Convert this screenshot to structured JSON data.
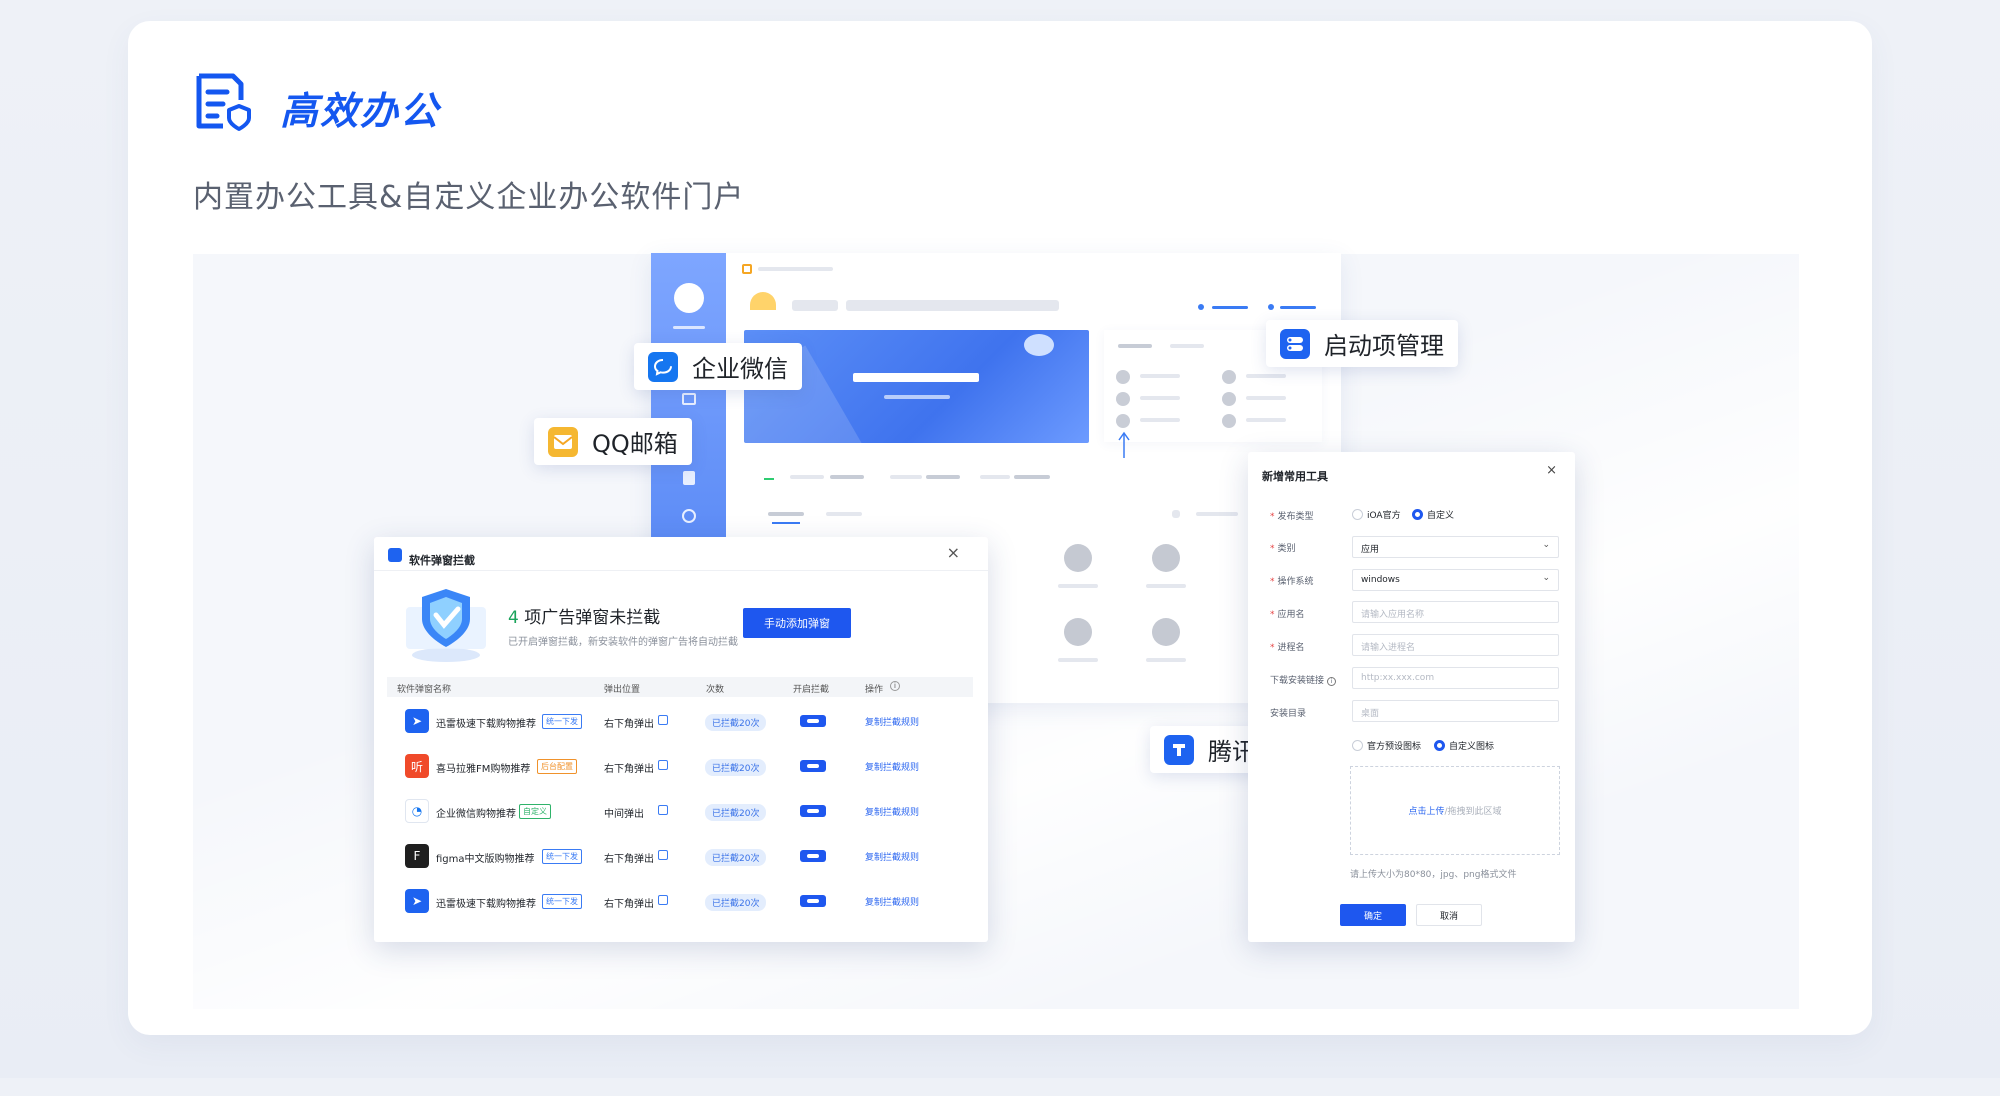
{
  "header": {
    "title": "高效办公",
    "subtitle": "内置办公工具&自定义企业办公软件门户"
  },
  "tags": {
    "wecom": "企业微信",
    "qqmail": "QQ邮箱",
    "startup": "启动项管理",
    "tdocs": "腾讯文档"
  },
  "popup": {
    "title": "软件弹窗拦截",
    "count_num": "4",
    "count_text": " 项广告弹窗未拦截",
    "desc": "已开启弹窗拦截，新安装软件的弹窗广告将自动拦截",
    "add_button": "手动添加弹窗",
    "close": "×",
    "columns": [
      "软件弹窗名称",
      "弹出位置",
      "次数",
      "开启拦截",
      "操作"
    ],
    "rows": [
      {
        "name": "迅雷极速下载购物推荐",
        "badge": "统一下发",
        "position": "右下角弹出",
        "count": "已拦截20次",
        "action": "复制拦截规则",
        "color": "#1e63f0",
        "glyph": "➤"
      },
      {
        "name": "喜马拉雅FM购物推荐",
        "badge": "后台配置",
        "position": "右下角弹出",
        "count": "已拦截20次",
        "action": "复制拦截规则",
        "color": "#f04a2a",
        "glyph": "听"
      },
      {
        "name": "企业微信购物推荐",
        "badge": "自定义",
        "position": "中间弹出",
        "count": "已拦截20次",
        "action": "复制拦截规则",
        "color": "#ffffff",
        "glyph": "◔"
      },
      {
        "name": "figma中文版购物推荐",
        "badge": "统一下发",
        "position": "右下角弹出",
        "count": "已拦截20次",
        "action": "复制拦截规则",
        "color": "#1f1f1f",
        "glyph": "F"
      },
      {
        "name": "迅雷极速下载购物推荐",
        "badge": "统一下发",
        "position": "右下角弹出",
        "count": "已拦截20次",
        "action": "复制拦截规则",
        "color": "#1e63f0",
        "glyph": "➤"
      }
    ]
  },
  "form": {
    "title": "新增常用工具",
    "close": "×",
    "fields": {
      "publish_type": "发布类型",
      "category": "类别",
      "os": "操作系统",
      "app_name": "应用名",
      "process_name": "进程名",
      "download_link": "下载安装链接",
      "install_dir": "安装目录"
    },
    "radio_ioa": "iOA官方",
    "radio_custom": "自定义",
    "category_value": "应用",
    "os_value": "windows",
    "app_name_placeholder": "请输入应用名称",
    "process_placeholder": "请输入进程名",
    "link_placeholder": "http:xx.xxx.com",
    "dir_placeholder": "桌面",
    "icon_preset": "官方预设图标",
    "icon_custom": "自定义图标",
    "upload_link": "点击上传",
    "upload_text": "/拖拽到此区域",
    "upload_hint": "请上传大小为80*80，jpg、png格式文件",
    "ok": "确定",
    "cancel": "取消"
  },
  "colors": {
    "brand": "#1457f0",
    "primary_button": "#1e57ef"
  }
}
